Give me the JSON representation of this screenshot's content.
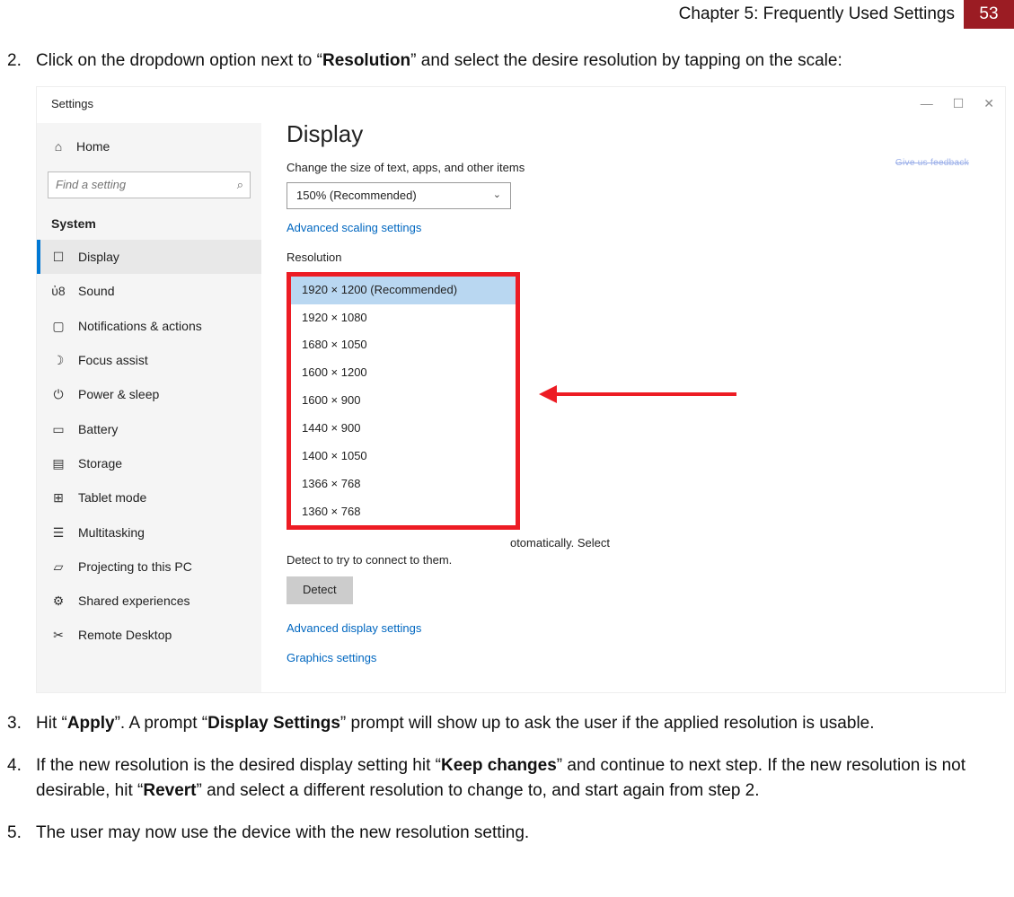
{
  "header": {
    "chapter": "Chapter 5: Frequently Used Settings",
    "page_number": "53"
  },
  "steps": {
    "s2": {
      "num": "2.",
      "t1": "Click on the dropdown option next to “",
      "b1": "Resolution",
      "t2": "” and select the desire resolution by tapping on the scale:"
    },
    "s3": {
      "num": "3.",
      "t1": "Hit “",
      "b1": "Apply",
      "t2": "”. A prompt “",
      "b2": "Display Settings",
      "t3": "” prompt will show up to ask the user if the applied resolution is usable."
    },
    "s4": {
      "num": "4.",
      "t1": "If the new resolution is the desired display setting hit “",
      "b1": "Keep changes",
      "t2": "” and continue to next step. If the new resolution is not desirable, hit “",
      "b2": "Revert",
      "t3": "” and select a different resolution to change to, and start again from step 2."
    },
    "s5": {
      "num": "5.",
      "t1": "The user may now use the device with the new resolution setting."
    }
  },
  "win": {
    "title": "Settings",
    "minimize": "—",
    "maximize": "☐",
    "close": "✕",
    "home": "Home",
    "search_placeholder": "Find a setting",
    "section": "System",
    "items": [
      {
        "icon": "☐",
        "label": "Display",
        "selected": true
      },
      {
        "icon": "ὐ8",
        "label": "Sound"
      },
      {
        "icon": "▢",
        "label": "Notifications & actions"
      },
      {
        "icon": "☽",
        "label": "Focus assist"
      },
      {
        "icon": "⏻",
        "label": "Power & sleep"
      },
      {
        "icon": "▭",
        "label": "Battery"
      },
      {
        "icon": "▤",
        "label": "Storage"
      },
      {
        "icon": "⊞",
        "label": "Tablet mode"
      },
      {
        "icon": "☰",
        "label": "Multitasking"
      },
      {
        "icon": "▱",
        "label": "Projecting to this PC"
      },
      {
        "icon": "⚙",
        "label": "Shared experiences"
      },
      {
        "icon": "✂",
        "label": "Remote Desktop"
      }
    ],
    "content": {
      "title": "Display",
      "scale_label": "Change the size of text, apps, and other items",
      "scale_value": "150% (Recommended)",
      "adv_scaling": "Advanced scaling settings",
      "res_label": "Resolution",
      "resolutions": [
        "1920 × 1200 (Recommended)",
        "1920 × 1080",
        "1680 × 1050",
        "1600 × 1200",
        "1600 × 900",
        "1440 × 900",
        "1400 × 1050",
        "1366 × 768",
        "1360 × 768"
      ],
      "below_text": "Detect to try to connect to them.",
      "below_suffix": "otomatically. Select",
      "detect": "Detect",
      "adv_display": "Advanced display settings",
      "graphics": "Graphics settings",
      "feedback": "Give us feedback"
    }
  }
}
